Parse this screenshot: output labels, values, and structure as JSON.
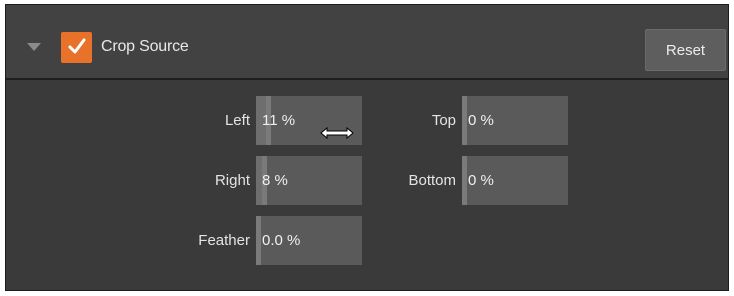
{
  "header": {
    "title": "Crop Source",
    "reset_label": "Reset",
    "enabled": true
  },
  "fields": {
    "left": {
      "label": "Left",
      "value": "11 %",
      "fraction": 0.11
    },
    "top": {
      "label": "Top",
      "value": "0 %",
      "fraction": 0.0
    },
    "right": {
      "label": "Right",
      "value": "8 %",
      "fraction": 0.08
    },
    "bottom": {
      "label": "Bottom",
      "value": "0 %",
      "fraction": 0.0
    },
    "feather": {
      "label": "Feather",
      "value": "0.0 %",
      "fraction": 0.0
    }
  },
  "colors": {
    "accent": "#e9722b",
    "panel": "#3a3a3a",
    "field": "#5a5a5a"
  },
  "icons": {
    "collapse": "chevron-down-icon",
    "check": "checkmark-icon",
    "cursor": "resize-horizontal-cursor-icon"
  }
}
